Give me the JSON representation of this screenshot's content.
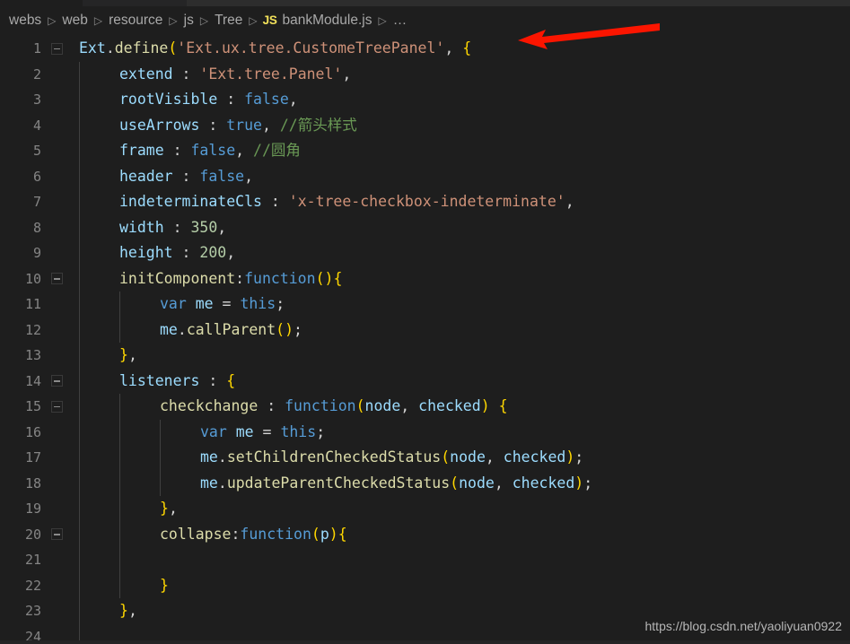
{
  "window": {
    "theme_background": "#1e1e1e",
    "tabstrip_background": "#252526"
  },
  "breadcrumb": {
    "name": "breadcrumb",
    "items": [
      {
        "label": "webs",
        "icon": ""
      },
      {
        "label": "web",
        "icon": ""
      },
      {
        "label": "resource",
        "icon": ""
      },
      {
        "label": "js",
        "icon": ""
      },
      {
        "label": "Tree",
        "icon": ""
      },
      {
        "label": "bankModule.js",
        "icon": "JS"
      },
      {
        "label": "…",
        "icon": ""
      }
    ],
    "separator": "▷",
    "js_icon_label": "JS",
    "js_icon_color": "#f1e05a"
  },
  "editor": {
    "language": "javascript",
    "filename": "bankModule.js",
    "font_size_px": 16.5,
    "line_height_px": 28.5,
    "first_line": 1,
    "last_visible_line": 24,
    "gutter_color": "#858585",
    "lines": [
      {
        "n": 1,
        "fold": true,
        "indent": 0,
        "tokens": [
          {
            "t": "Ext",
            "c": "t-prop"
          },
          {
            "t": ".",
            "c": "t-plain"
          },
          {
            "t": "define",
            "c": "t-fn"
          },
          {
            "t": "(",
            "c": "t-brkt1"
          },
          {
            "t": "'Ext.ux.tree.CustomeTreePanel'",
            "c": "t-str"
          },
          {
            "t": ", ",
            "c": "t-plain"
          },
          {
            "t": "{",
            "c": "t-brkt1"
          }
        ]
      },
      {
        "n": 2,
        "fold": false,
        "indent": 1,
        "tokens": [
          {
            "t": "extend",
            "c": "t-prop"
          },
          {
            "t": " : ",
            "c": "t-plain"
          },
          {
            "t": "'Ext.tree.Panel'",
            "c": "t-str"
          },
          {
            "t": ",",
            "c": "t-plain"
          }
        ]
      },
      {
        "n": 3,
        "fold": false,
        "indent": 1,
        "tokens": [
          {
            "t": "rootVisible",
            "c": "t-prop"
          },
          {
            "t": " : ",
            "c": "t-plain"
          },
          {
            "t": "false",
            "c": "t-kw"
          },
          {
            "t": ",",
            "c": "t-plain"
          }
        ]
      },
      {
        "n": 4,
        "fold": false,
        "indent": 1,
        "tokens": [
          {
            "t": "useArrows",
            "c": "t-prop"
          },
          {
            "t": " : ",
            "c": "t-plain"
          },
          {
            "t": "true",
            "c": "t-kw"
          },
          {
            "t": ", ",
            "c": "t-plain"
          },
          {
            "t": "//箭头样式",
            "c": "t-cmt"
          }
        ]
      },
      {
        "n": 5,
        "fold": false,
        "indent": 1,
        "tokens": [
          {
            "t": "frame",
            "c": "t-prop"
          },
          {
            "t": " : ",
            "c": "t-plain"
          },
          {
            "t": "false",
            "c": "t-kw"
          },
          {
            "t": ", ",
            "c": "t-plain"
          },
          {
            "t": "//圆角",
            "c": "t-cmt"
          }
        ]
      },
      {
        "n": 6,
        "fold": false,
        "indent": 1,
        "tokens": [
          {
            "t": "header",
            "c": "t-prop"
          },
          {
            "t": " : ",
            "c": "t-plain"
          },
          {
            "t": "false",
            "c": "t-kw"
          },
          {
            "t": ",",
            "c": "t-plain"
          }
        ]
      },
      {
        "n": 7,
        "fold": false,
        "indent": 1,
        "tokens": [
          {
            "t": "indeterminateCls",
            "c": "t-prop"
          },
          {
            "t": " : ",
            "c": "t-plain"
          },
          {
            "t": "'x-tree-checkbox-indeterminate'",
            "c": "t-str"
          },
          {
            "t": ",",
            "c": "t-plain"
          }
        ]
      },
      {
        "n": 8,
        "fold": false,
        "indent": 1,
        "tokens": [
          {
            "t": "width",
            "c": "t-prop"
          },
          {
            "t": " : ",
            "c": "t-plain"
          },
          {
            "t": "350",
            "c": "t-num"
          },
          {
            "t": ",",
            "c": "t-plain"
          }
        ]
      },
      {
        "n": 9,
        "fold": false,
        "indent": 1,
        "tokens": [
          {
            "t": "height",
            "c": "t-prop"
          },
          {
            "t": " : ",
            "c": "t-plain"
          },
          {
            "t": "200",
            "c": "t-num"
          },
          {
            "t": ",",
            "c": "t-plain"
          }
        ]
      },
      {
        "n": 10,
        "fold": true,
        "indent": 1,
        "tokens": [
          {
            "t": "initComponent",
            "c": "t-fn"
          },
          {
            "t": ":",
            "c": "t-plain"
          },
          {
            "t": "function",
            "c": "t-kw"
          },
          {
            "t": "()",
            "c": "t-brkt1"
          },
          {
            "t": "{",
            "c": "t-brkt1"
          }
        ]
      },
      {
        "n": 11,
        "fold": false,
        "indent": 2,
        "tokens": [
          {
            "t": "var",
            "c": "t-kw"
          },
          {
            "t": " ",
            "c": "t-plain"
          },
          {
            "t": "me",
            "c": "t-prop"
          },
          {
            "t": " = ",
            "c": "t-plain"
          },
          {
            "t": "this",
            "c": "t-kw"
          },
          {
            "t": ";",
            "c": "t-plain"
          }
        ]
      },
      {
        "n": 12,
        "fold": false,
        "indent": 2,
        "tokens": [
          {
            "t": "me",
            "c": "t-prop"
          },
          {
            "t": ".",
            "c": "t-plain"
          },
          {
            "t": "callParent",
            "c": "t-fn"
          },
          {
            "t": "()",
            "c": "t-brkt1"
          },
          {
            "t": ";",
            "c": "t-plain"
          }
        ]
      },
      {
        "n": 13,
        "fold": false,
        "indent": 1,
        "tokens": [
          {
            "t": "}",
            "c": "t-brkt1"
          },
          {
            "t": ",",
            "c": "t-plain"
          }
        ]
      },
      {
        "n": 14,
        "fold": true,
        "indent": 1,
        "tokens": [
          {
            "t": "listeners",
            "c": "t-prop"
          },
          {
            "t": " : ",
            "c": "t-plain"
          },
          {
            "t": "{",
            "c": "t-brkt1"
          }
        ]
      },
      {
        "n": 15,
        "fold": true,
        "indent": 2,
        "tokens": [
          {
            "t": "checkchange",
            "c": "t-fn"
          },
          {
            "t": " : ",
            "c": "t-plain"
          },
          {
            "t": "function",
            "c": "t-kw"
          },
          {
            "t": "(",
            "c": "t-brkt1"
          },
          {
            "t": "node",
            "c": "t-prop"
          },
          {
            "t": ", ",
            "c": "t-plain"
          },
          {
            "t": "checked",
            "c": "t-prop"
          },
          {
            "t": ")",
            "c": "t-brkt1"
          },
          {
            "t": " ",
            "c": "t-plain"
          },
          {
            "t": "{",
            "c": "t-brkt1"
          }
        ]
      },
      {
        "n": 16,
        "fold": false,
        "indent": 3,
        "tokens": [
          {
            "t": "var",
            "c": "t-kw"
          },
          {
            "t": " ",
            "c": "t-plain"
          },
          {
            "t": "me",
            "c": "t-prop"
          },
          {
            "t": " = ",
            "c": "t-plain"
          },
          {
            "t": "this",
            "c": "t-kw"
          },
          {
            "t": ";",
            "c": "t-plain"
          }
        ]
      },
      {
        "n": 17,
        "fold": false,
        "indent": 3,
        "tokens": [
          {
            "t": "me",
            "c": "t-prop"
          },
          {
            "t": ".",
            "c": "t-plain"
          },
          {
            "t": "setChildrenCheckedStatus",
            "c": "t-fn"
          },
          {
            "t": "(",
            "c": "t-brkt1"
          },
          {
            "t": "node",
            "c": "t-prop"
          },
          {
            "t": ", ",
            "c": "t-plain"
          },
          {
            "t": "checked",
            "c": "t-prop"
          },
          {
            "t": ")",
            "c": "t-brkt1"
          },
          {
            "t": ";",
            "c": "t-plain"
          }
        ]
      },
      {
        "n": 18,
        "fold": false,
        "indent": 3,
        "tokens": [
          {
            "t": "me",
            "c": "t-prop"
          },
          {
            "t": ".",
            "c": "t-plain"
          },
          {
            "t": "updateParentCheckedStatus",
            "c": "t-fn"
          },
          {
            "t": "(",
            "c": "t-brkt1"
          },
          {
            "t": "node",
            "c": "t-prop"
          },
          {
            "t": ", ",
            "c": "t-plain"
          },
          {
            "t": "checked",
            "c": "t-prop"
          },
          {
            "t": ")",
            "c": "t-brkt1"
          },
          {
            "t": ";",
            "c": "t-plain"
          }
        ]
      },
      {
        "n": 19,
        "fold": false,
        "indent": 2,
        "tokens": [
          {
            "t": "}",
            "c": "t-brkt1"
          },
          {
            "t": ",",
            "c": "t-plain"
          }
        ]
      },
      {
        "n": 20,
        "fold": true,
        "indent": 2,
        "tokens": [
          {
            "t": "collapse",
            "c": "t-fn"
          },
          {
            "t": ":",
            "c": "t-plain"
          },
          {
            "t": "function",
            "c": "t-kw"
          },
          {
            "t": "(",
            "c": "t-brkt1"
          },
          {
            "t": "p",
            "c": "t-prop"
          },
          {
            "t": ")",
            "c": "t-brkt1"
          },
          {
            "t": "{",
            "c": "t-brkt1"
          }
        ]
      },
      {
        "n": 21,
        "fold": false,
        "indent": 0,
        "tokens": []
      },
      {
        "n": 22,
        "fold": false,
        "indent": 2,
        "tokens": [
          {
            "t": "}",
            "c": "t-brkt1"
          }
        ]
      },
      {
        "n": 23,
        "fold": false,
        "indent": 1,
        "tokens": [
          {
            "t": "}",
            "c": "t-brkt1"
          },
          {
            "t": ",",
            "c": "t-plain"
          }
        ]
      },
      {
        "n": 24,
        "fold": false,
        "indent": 0,
        "tokens": []
      }
    ]
  },
  "annotation": {
    "type": "arrow",
    "color": "#fb1500",
    "direction": "left",
    "points_at_line": 1
  },
  "watermark": {
    "text": "https://blog.csdn.net/yaoliyuan0922"
  }
}
